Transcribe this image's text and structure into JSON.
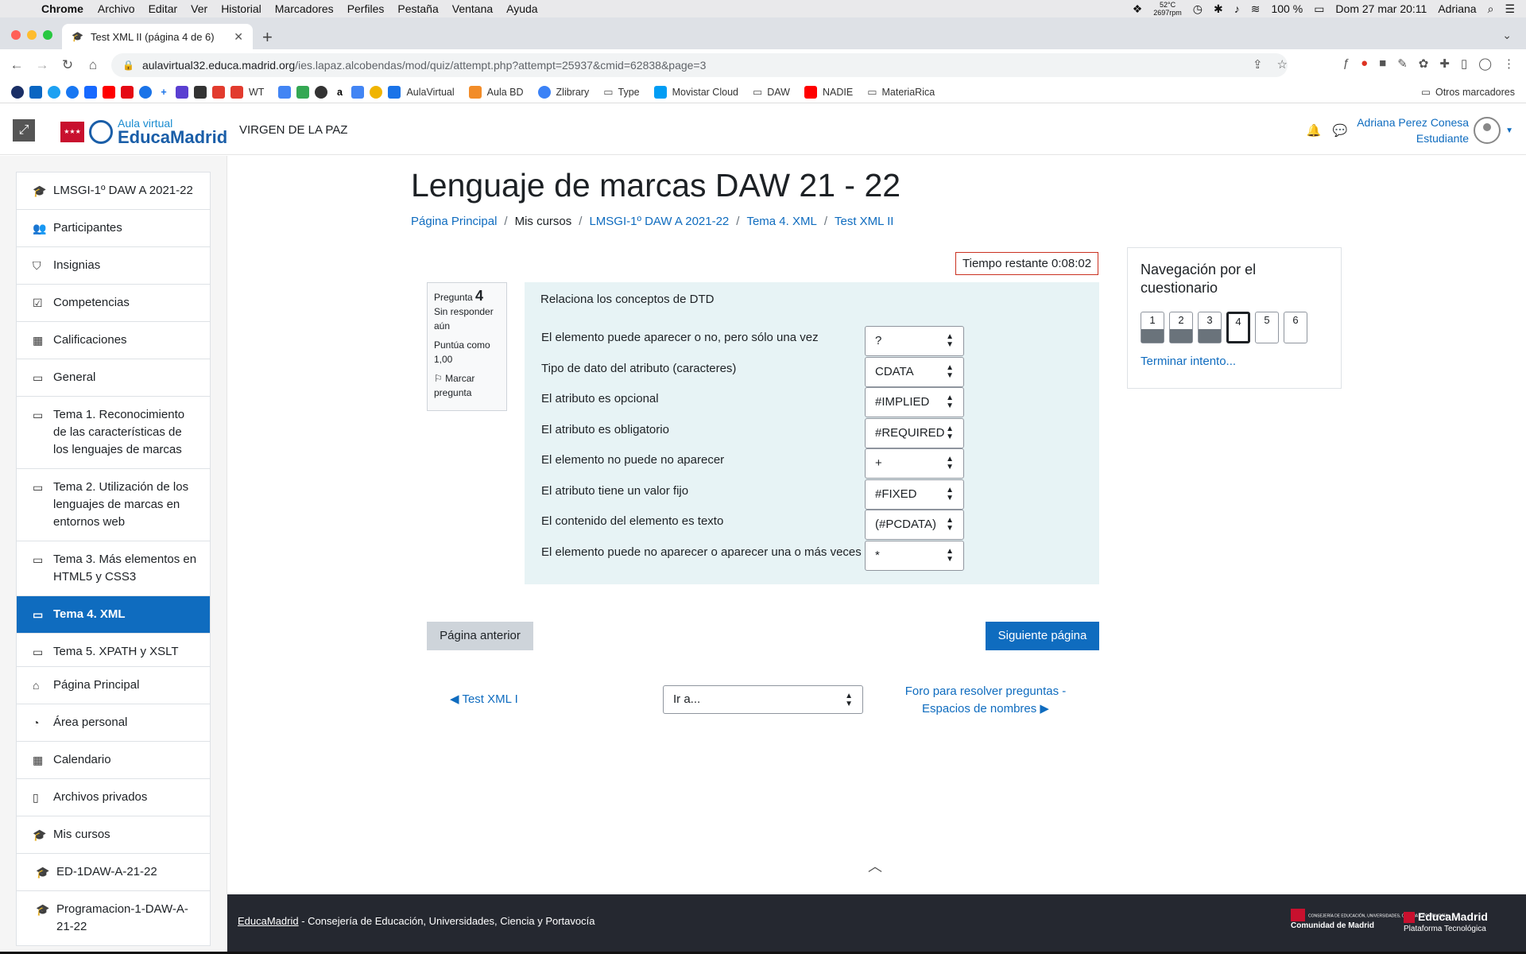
{
  "menubar": {
    "app": "Chrome",
    "items": [
      "Archivo",
      "Editar",
      "Ver",
      "Historial",
      "Marcadores",
      "Perfiles",
      "Pestaña",
      "Ventana",
      "Ayuda"
    ],
    "temp_line1": "52°C",
    "temp_line2": "2697rpm",
    "battery": "100 %",
    "datetime": "Dom 27 mar  20:11",
    "user": "Adriana"
  },
  "browser": {
    "tab_title": "Test XML II (página 4 de 6)",
    "url_host": "aulavirtual32.educa.madrid.org",
    "url_path": "/ies.lapaz.alcobendas/mod/quiz/attempt.php?attempt=25937&cmid=62838&page=3",
    "bookmarks": [
      "WT",
      "AulaVirtual",
      "Aula BD",
      "Zlibrary",
      "Type",
      "Movistar Cloud",
      "DAW",
      "NADIE",
      "MateriaRica"
    ],
    "other_bookmarks": "Otros marcadores"
  },
  "site": {
    "logo_line1": "Aula virtual",
    "logo_line2": "EducaMadrid",
    "name": "VIRGEN DE LA PAZ",
    "user_name": "Adriana Perez Conesa",
    "user_role": "Estudiante"
  },
  "drawer": {
    "course_items": [
      {
        "label": "LMSGI-1º DAW A 2021-22",
        "icon": "graduation-cap-icon"
      },
      {
        "label": "Participantes",
        "icon": "users-icon"
      },
      {
        "label": "Insignias",
        "icon": "shield-icon"
      },
      {
        "label": "Competencias",
        "icon": "check-square-icon"
      },
      {
        "label": "Calificaciones",
        "icon": "table-icon"
      },
      {
        "label": "General",
        "icon": "folder-icon"
      },
      {
        "label": "Tema 1. Reconocimiento de las características de los lenguajes de marcas",
        "icon": "folder-icon"
      },
      {
        "label": "Tema 2. Utilización de los lenguajes de marcas en entornos web",
        "icon": "folder-icon"
      },
      {
        "label": "Tema 3. Más elementos en HTML5 y CSS3",
        "icon": "folder-icon"
      },
      {
        "label": "Tema 4. XML",
        "icon": "folder-icon",
        "active": true
      },
      {
        "label": "Tema 5. XPATH y XSLT",
        "icon": "folder-icon"
      }
    ],
    "site_items": [
      {
        "label": "Página Principal",
        "icon": "home-icon"
      },
      {
        "label": "Área personal",
        "icon": "dashboard-icon"
      },
      {
        "label": "Calendario",
        "icon": "calendar-icon"
      },
      {
        "label": "Archivos privados",
        "icon": "file-icon"
      },
      {
        "label": "Mis cursos",
        "icon": "graduation-cap-icon"
      },
      {
        "label": "ED-1DAW-A-21-22",
        "icon": "graduation-cap-icon"
      },
      {
        "label": "Programacion-1-DAW-A-21-22",
        "icon": "graduation-cap-icon"
      }
    ]
  },
  "main": {
    "title": "Lenguaje de marcas DAW 21 - 22",
    "breadcrumb": [
      "Página Principal",
      "Mis cursos",
      "LMSGI-1º DAW A 2021-22",
      "Tema 4. XML",
      "Test XML II"
    ],
    "timer": "Tiempo restante 0:08:02"
  },
  "question": {
    "label": "Pregunta",
    "number": "4",
    "state": "Sin responder aún",
    "grade": "Puntúa como 1,00",
    "flag": "Marcar pregunta",
    "text": "Relaciona los conceptos de DTD",
    "rows": [
      {
        "stem": "El elemento puede aparecer o no, pero sólo una vez",
        "answer": "?"
      },
      {
        "stem": "Tipo de dato del atributo (caracteres)",
        "answer": "CDATA"
      },
      {
        "stem": "El atributo es opcional",
        "answer": "#IMPLIED"
      },
      {
        "stem": "El atributo es obligatorio",
        "answer": "#REQUIRED"
      },
      {
        "stem": "El elemento no puede no aparecer",
        "answer": "+"
      },
      {
        "stem": "El atributo tiene un valor fijo",
        "answer": "#FIXED"
      },
      {
        "stem": "El contenido del elemento es texto",
        "answer": "(#PCDATA)"
      },
      {
        "stem": "El elemento puede no aparecer o aparecer una o más veces",
        "answer": "*"
      }
    ]
  },
  "controls": {
    "prev_page": "Página anterior",
    "next_page": "Siguiente página",
    "prev_activity": "Test XML I",
    "jump_to": "Ir a...",
    "next_activity": "Foro para resolver preguntas - Espacios de nombres"
  },
  "quiz_nav": {
    "title": "Navegación por el cuestionario",
    "pages": [
      {
        "n": "1",
        "state": "answered"
      },
      {
        "n": "2",
        "state": "answered"
      },
      {
        "n": "3",
        "state": "answered"
      },
      {
        "n": "4",
        "state": "current"
      },
      {
        "n": "5",
        "state": "empty"
      },
      {
        "n": "6",
        "state": "empty"
      }
    ],
    "finish": "Terminar intento..."
  },
  "footer": {
    "link": "EducaMadrid",
    "text": " - Consejería de Educación, Universidades, Ciencia y Portavocía",
    "logo1_line1": "CONSEJERÍA DE EDUCACIÓN, UNIVERSIDADES, CIENCIA Y PORTAVOCÍA",
    "logo1_line2": "Comunidad de Madrid",
    "logo2_line1": "EducaMadrid",
    "logo2_line2": "Plataforma Tecnológica"
  }
}
